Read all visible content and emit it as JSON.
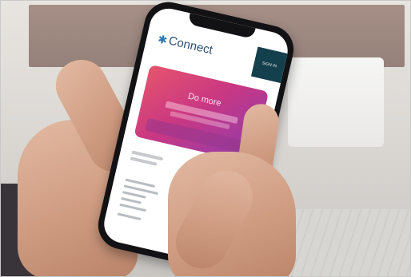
{
  "app": {
    "logo_text": "Connect",
    "logo_icon": "star-icon",
    "header_button": "SIGN IN"
  },
  "promo": {
    "title": "Do more"
  },
  "colors": {
    "brand_blue": "#2b4e77",
    "header_button_bg": "#143f4d",
    "promo_gradient_start": "#e6546d",
    "promo_gradient_end": "#8f3aa1"
  }
}
